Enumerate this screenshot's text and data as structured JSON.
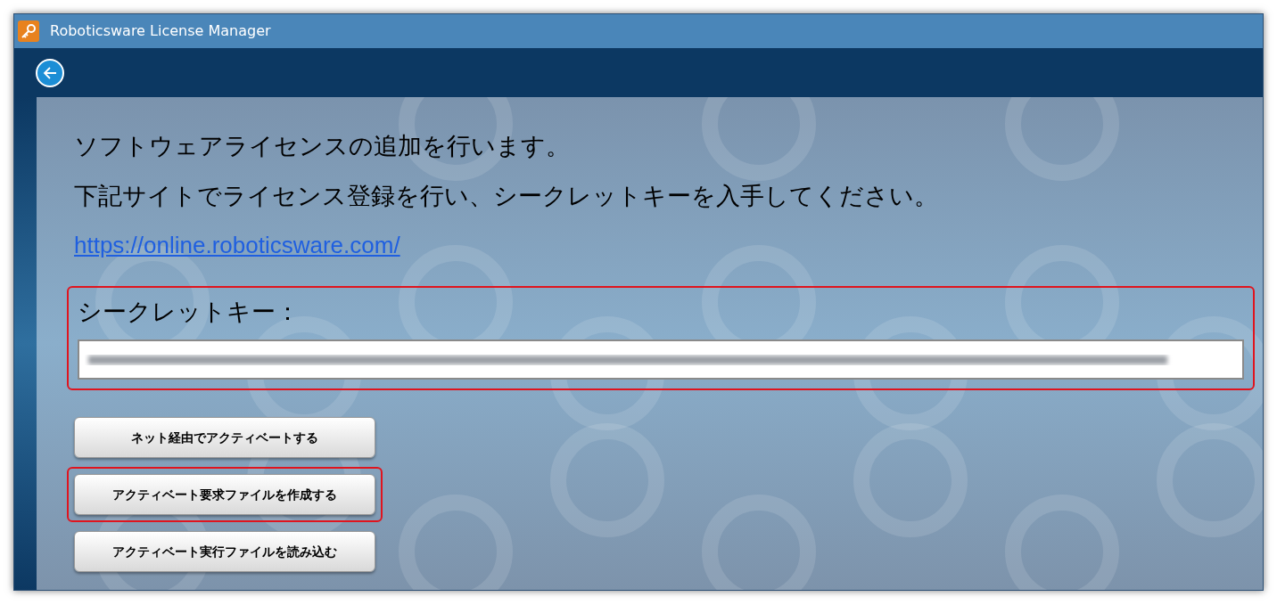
{
  "window": {
    "title": "Roboticsware License Manager"
  },
  "intro": [
    "ソフトウェアライセンスの追加を行います。",
    "下記サイトでライセンス登録を行い、シークレットキーを入手してください。"
  ],
  "link": "https://online.roboticsware.com/",
  "secret_key": {
    "label": "シークレットキー：",
    "highlighted": true
  },
  "buttons": [
    {
      "label": "ネット経由でアクティベートする",
      "highlighted": false
    },
    {
      "label": "アクティベート要求ファイルを作成する",
      "highlighted": true
    },
    {
      "label": "アクティベート実行ファイルを読み込む",
      "highlighted": false
    }
  ]
}
